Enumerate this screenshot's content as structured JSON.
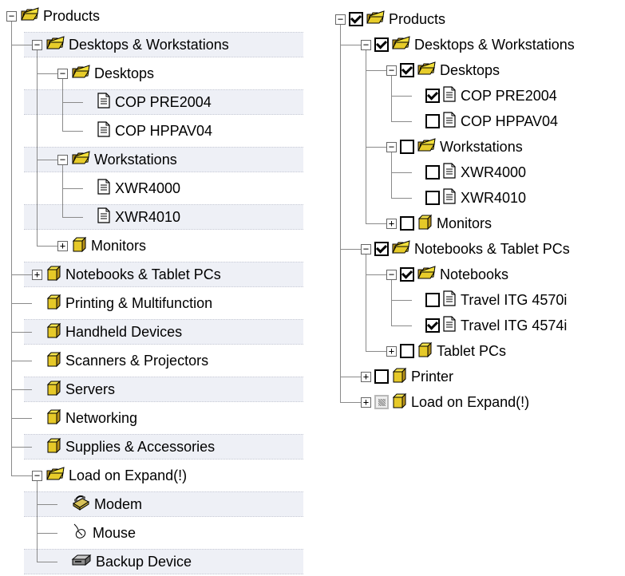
{
  "left_tree": [
    {
      "label": "Products",
      "level": 0,
      "expander": "minus",
      "icon": "folder-open-icon",
      "stripe": false
    },
    {
      "label": "Desktops & Workstations",
      "level": 1,
      "expander": "minus",
      "icon": "folder-open-icon",
      "stripe": true
    },
    {
      "label": "Desktops",
      "level": 2,
      "expander": "minus",
      "icon": "folder-open-icon",
      "stripe": false
    },
    {
      "label": "COP PRE2004",
      "level": 3,
      "expander": "none",
      "icon": "document-icon",
      "stripe": true
    },
    {
      "label": "COP HPPAV04",
      "level": 3,
      "expander": "none",
      "icon": "document-icon",
      "stripe": false
    },
    {
      "label": "Workstations",
      "level": 2,
      "expander": "minus",
      "icon": "folder-open-icon",
      "stripe": true
    },
    {
      "label": "XWR4000",
      "level": 3,
      "expander": "none",
      "icon": "document-icon",
      "stripe": false
    },
    {
      "label": "XWR4010",
      "level": 3,
      "expander": "none",
      "icon": "document-icon",
      "stripe": true
    },
    {
      "label": "Monitors",
      "level": 2,
      "expander": "plus",
      "icon": "folder-closed-icon",
      "stripe": false
    },
    {
      "label": "Notebooks & Tablet PCs",
      "level": 1,
      "expander": "plus",
      "icon": "folder-closed-icon",
      "stripe": true
    },
    {
      "label": "Printing & Multifunction",
      "level": 1,
      "expander": "none",
      "icon": "folder-closed-icon",
      "stripe": false
    },
    {
      "label": "Handheld Devices",
      "level": 1,
      "expander": "none",
      "icon": "folder-closed-icon",
      "stripe": true
    },
    {
      "label": "Scanners & Projectors",
      "level": 1,
      "expander": "none",
      "icon": "folder-closed-icon",
      "stripe": false
    },
    {
      "label": "Servers",
      "level": 1,
      "expander": "none",
      "icon": "folder-closed-icon",
      "stripe": true
    },
    {
      "label": "Networking",
      "level": 1,
      "expander": "none",
      "icon": "folder-closed-icon",
      "stripe": false
    },
    {
      "label": "Supplies & Accessories",
      "level": 1,
      "expander": "none",
      "icon": "folder-closed-icon",
      "stripe": true
    },
    {
      "label": "Load on Expand(!)",
      "level": 1,
      "expander": "minus",
      "icon": "folder-open-icon",
      "stripe": false
    },
    {
      "label": "Modem",
      "level": 2,
      "expander": "none",
      "icon": "modem-icon",
      "stripe": true
    },
    {
      "label": "Mouse",
      "level": 2,
      "expander": "none",
      "icon": "mouse-icon",
      "stripe": false
    },
    {
      "label": "Backup Device",
      "level": 2,
      "expander": "none",
      "icon": "backup-drive-icon",
      "stripe": true
    }
  ],
  "right_tree": [
    {
      "label": "Products",
      "level": 0,
      "expander": "minus",
      "check": "checked",
      "icon": "folder-open-icon"
    },
    {
      "label": "Desktops & Workstations",
      "level": 1,
      "expander": "minus",
      "check": "checked",
      "icon": "folder-open-icon"
    },
    {
      "label": "Desktops",
      "level": 2,
      "expander": "minus",
      "check": "checked",
      "icon": "folder-open-icon"
    },
    {
      "label": "COP PRE2004",
      "level": 3,
      "expander": "none",
      "check": "checked",
      "icon": "document-icon"
    },
    {
      "label": "COP HPPAV04",
      "level": 3,
      "expander": "none",
      "check": "unchecked",
      "icon": "document-icon"
    },
    {
      "label": "Workstations",
      "level": 2,
      "expander": "minus",
      "check": "unchecked",
      "icon": "folder-open-icon"
    },
    {
      "label": "XWR4000",
      "level": 3,
      "expander": "none",
      "check": "unchecked",
      "icon": "document-icon"
    },
    {
      "label": "XWR4010",
      "level": 3,
      "expander": "none",
      "check": "unchecked",
      "icon": "document-icon"
    },
    {
      "label": "Monitors",
      "level": 2,
      "expander": "plus",
      "check": "unchecked",
      "icon": "folder-closed-icon"
    },
    {
      "label": "Notebooks & Tablet PCs",
      "level": 1,
      "expander": "minus",
      "check": "checked",
      "icon": "folder-open-icon"
    },
    {
      "label": "Notebooks",
      "level": 2,
      "expander": "minus",
      "check": "checked",
      "icon": "folder-open-icon"
    },
    {
      "label": "Travel ITG 4570i",
      "level": 3,
      "expander": "none",
      "check": "unchecked",
      "icon": "document-icon"
    },
    {
      "label": "Travel ITG 4574i",
      "level": 3,
      "expander": "none",
      "check": "checked",
      "icon": "document-icon"
    },
    {
      "label": "Tablet PCs",
      "level": 2,
      "expander": "plus",
      "check": "unchecked",
      "icon": "folder-closed-icon"
    },
    {
      "label": "Printer",
      "level": 1,
      "expander": "plus",
      "check": "unchecked",
      "icon": "folder-closed-icon"
    },
    {
      "label": "Load on Expand(!)",
      "level": 1,
      "expander": "plus",
      "check": "disabled",
      "icon": "folder-closed-icon"
    }
  ]
}
